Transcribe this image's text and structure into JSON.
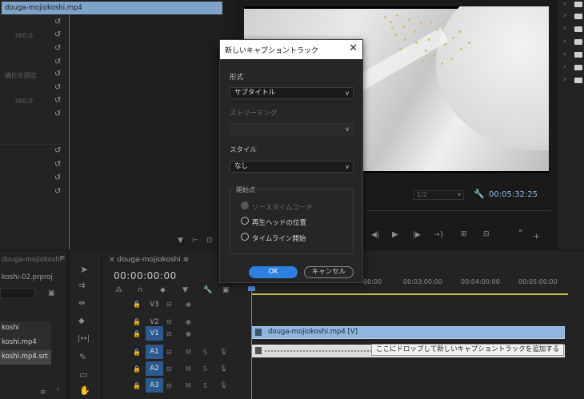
{
  "effect_panel": {
    "values": [
      "360.0",
      "360.0"
    ],
    "dim_label": "構比を固定"
  },
  "source": {
    "clip_name": "douga-mojiokoshi.mp4"
  },
  "program": {
    "resolution": "1/2",
    "timecode": "00:05:32:25"
  },
  "project_bottom": {
    "tab_label": "douga-mojiokoshi",
    "project_file": "koshi-02.prproj",
    "items": [
      "koshi",
      "koshi.mp4",
      "koshi.mp4.srt"
    ]
  },
  "timeline": {
    "tab": "douga-mojiokoshi",
    "timecode": "00:00:00:00",
    "ruler": [
      "00:00",
      "00:03:00:00",
      "00:04:00:00",
      "00:05:00:00"
    ],
    "tracks_video": [
      "V3",
      "V2",
      "V1"
    ],
    "tracks_audio": [
      "A1",
      "A2",
      "A3"
    ],
    "v1_clip": "douga-mojiokoshi.mp4 [V]",
    "drop_tip": "ここにドロップして新しいキャプショントラックを追加する"
  },
  "dialog": {
    "title": "新しいキャプショントラック",
    "format_label": "形式",
    "format_value": "サブタイトル",
    "streaming_label": "ストリーミング",
    "style_label": "スタイル",
    "style_value": "なし",
    "start_label": "開始点",
    "radio_source": "ソースタイムコード",
    "radio_playhead": "再生ヘッドの位置",
    "radio_timeline": "タイムライン開始",
    "ok": "OK",
    "cancel": "キャンセル"
  },
  "colors": {
    "accent": "#2d7fe0",
    "track_active": "#2d5a8e",
    "clip_video": "#8fb6de",
    "playhead": "#4b86d4",
    "work_area": "#c8c23a"
  }
}
